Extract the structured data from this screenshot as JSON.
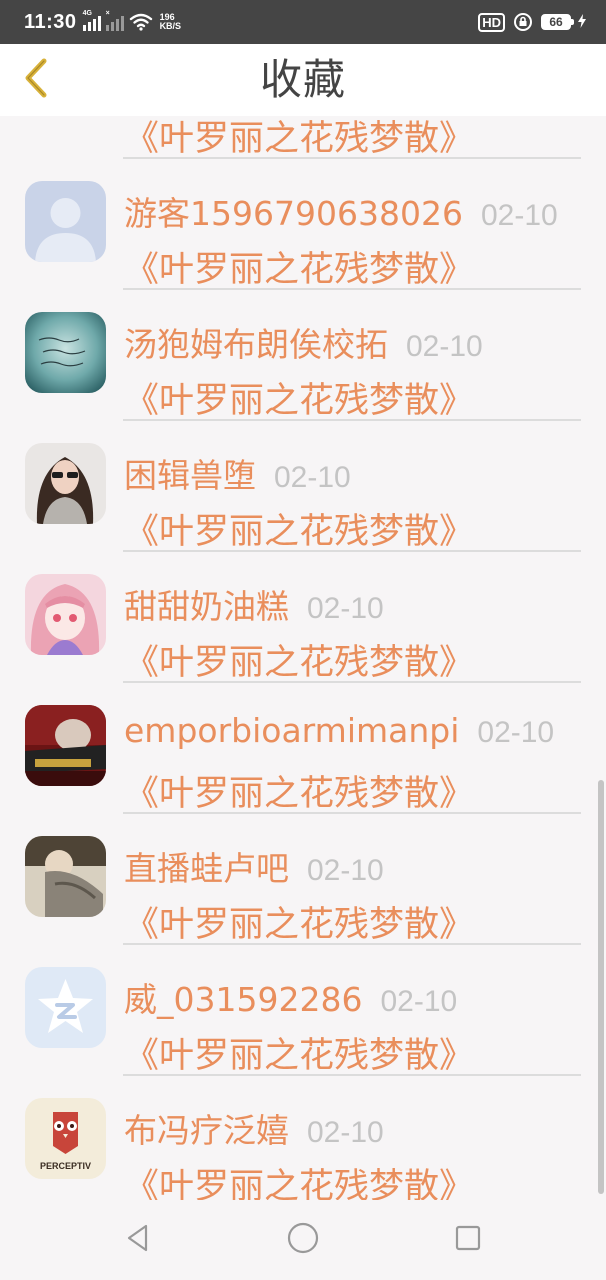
{
  "status_bar": {
    "time": "11:30",
    "sim1_tag": "4G",
    "sim2_tag": "×",
    "net_speed_value": "196",
    "net_speed_unit": "KB/S",
    "hd_label": "HD",
    "battery_level": "66",
    "icons": [
      "signal-icon",
      "wifi-icon",
      "hd-icon",
      "lock-rotation-icon",
      "battery-icon",
      "charging-icon"
    ]
  },
  "title_bar": {
    "title": "收藏",
    "back_icon": "chevron-left-icon"
  },
  "list": {
    "partial_top_book": "《叶罗丽之花残梦散》",
    "items": [
      {
        "name": "游客1596790638026",
        "date": "02-10",
        "book": "《叶罗丽之花残梦散》",
        "avatar": "default-user-avatar"
      },
      {
        "name": "汤狍姆布朗俟校拓",
        "date": "02-10",
        "book": "《叶罗丽之花残梦散》",
        "avatar": "teal-handwriting-avatar"
      },
      {
        "name": "困辑兽堕",
        "date": "02-10",
        "book": "《叶罗丽之花残梦散》",
        "avatar": "girl-sunglasses-avatar"
      },
      {
        "name": "甜甜奶油糕",
        "date": "02-10",
        "book": "《叶罗丽之花残梦散》",
        "avatar": "anime-pink-girl-avatar"
      },
      {
        "name": "emporbioarmimanpi",
        "date": "02-10",
        "book": "《叶罗丽之花残梦散》",
        "avatar": "red-photo-avatar"
      },
      {
        "name": "直播蛙卢吧",
        "date": "02-10",
        "book": "《叶罗丽之花残梦散》",
        "avatar": "sleeping-cat-avatar"
      },
      {
        "name": "威_031592286",
        "date": "02-10",
        "book": "《叶罗丽之花残梦散》",
        "avatar": "qq-star-avatar"
      },
      {
        "name": "布冯疗泛嬉",
        "date": "02-10",
        "book": "《叶罗丽之花残梦散》",
        "avatar": "perceptiv-owl-avatar"
      }
    ],
    "perceptiv_logo_text": "PERCEPTIV"
  },
  "nav_bar": {
    "buttons": [
      "back-triangle-icon",
      "home-circle-icon",
      "recents-square-icon"
    ]
  },
  "colors": {
    "accent": "#e98e5c",
    "date": "#c4c4c4",
    "status_bar": "#454545",
    "background": "#f7f5f6"
  }
}
